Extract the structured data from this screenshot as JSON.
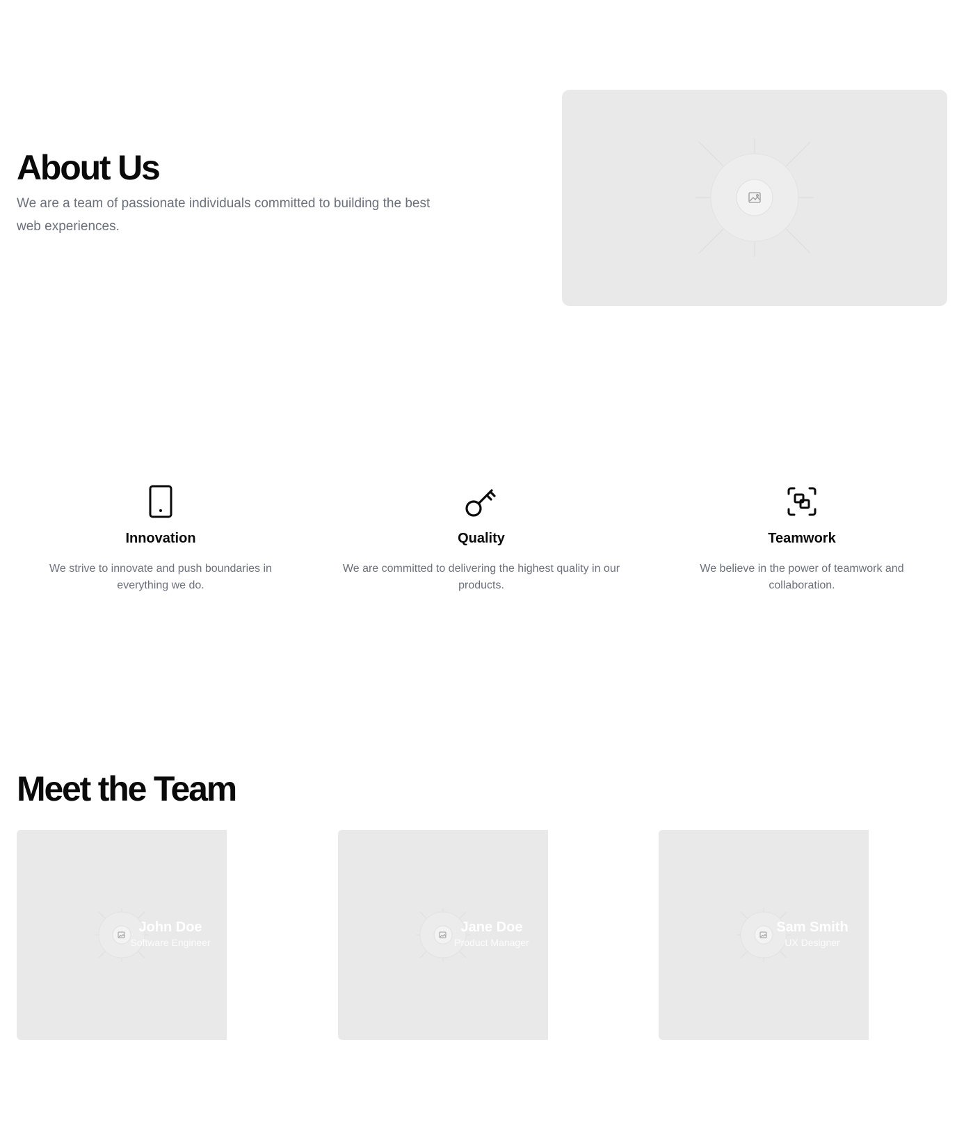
{
  "about": {
    "title": "About Us",
    "description": "We are a team of passionate individuals committed to building the best web experiences.",
    "image_icon": "image-icon"
  },
  "values": [
    {
      "icon": "tablet-icon",
      "title": "Innovation",
      "description": "We strive to innovate and push boundaries in everything we do."
    },
    {
      "icon": "key-icon",
      "title": "Quality",
      "description": "We are committed to delivering the highest quality in our products."
    },
    {
      "icon": "frame-icon",
      "title": "Teamwork",
      "description": "We believe in the power of teamwork and collaboration."
    }
  ],
  "team": {
    "title": "Meet the Team",
    "members": [
      {
        "name": "John Doe",
        "role": "Software Engineer"
      },
      {
        "name": "Jane Doe",
        "role": "Product Manager"
      },
      {
        "name": "Sam Smith",
        "role": "UX Designer"
      }
    ]
  },
  "colors": {
    "heading": "#0a0a0a",
    "muted_text": "#6b6f7a",
    "placeholder_bg": "#e9e9e9",
    "background": "#ffffff"
  }
}
